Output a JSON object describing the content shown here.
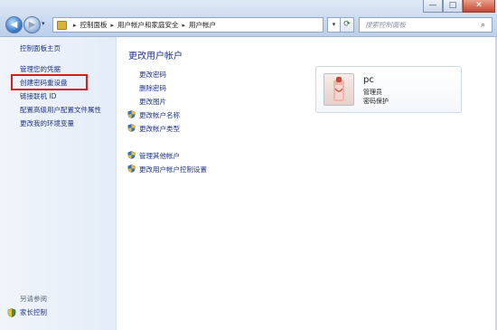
{
  "window": {
    "minimize_glyph": "—",
    "maximize_glyph": "□",
    "close_glyph": "✕"
  },
  "address_bar": {
    "breadcrumb": [
      "控制面板",
      "用户帐户和家庭安全",
      "用户帐户"
    ],
    "search_placeholder": "搜索控制面板"
  },
  "sidebar": {
    "home": "控制面板主页",
    "links": [
      "管理您的凭据",
      "创建密码重设盘",
      "链接联机 ID",
      "配置高级用户配置文件属性",
      "更改我的环境变量"
    ],
    "see_also": "另请参阅",
    "family_safety": "家长控制"
  },
  "main": {
    "heading": "更改用户帐户",
    "tasks_group1": [
      "更改密码",
      "删除密码",
      "更改图片"
    ],
    "tasks_group1_shield": [
      "更改帐户名称",
      "更改帐户类型"
    ],
    "tasks_group2_shield": [
      "管理其他帐户",
      "更改用户帐户控制设置"
    ]
  },
  "account": {
    "name": "pc",
    "role": "管理员",
    "status": "密码保护"
  },
  "colors": {
    "link": "#1e3287",
    "highlight": "#d31e1e"
  }
}
